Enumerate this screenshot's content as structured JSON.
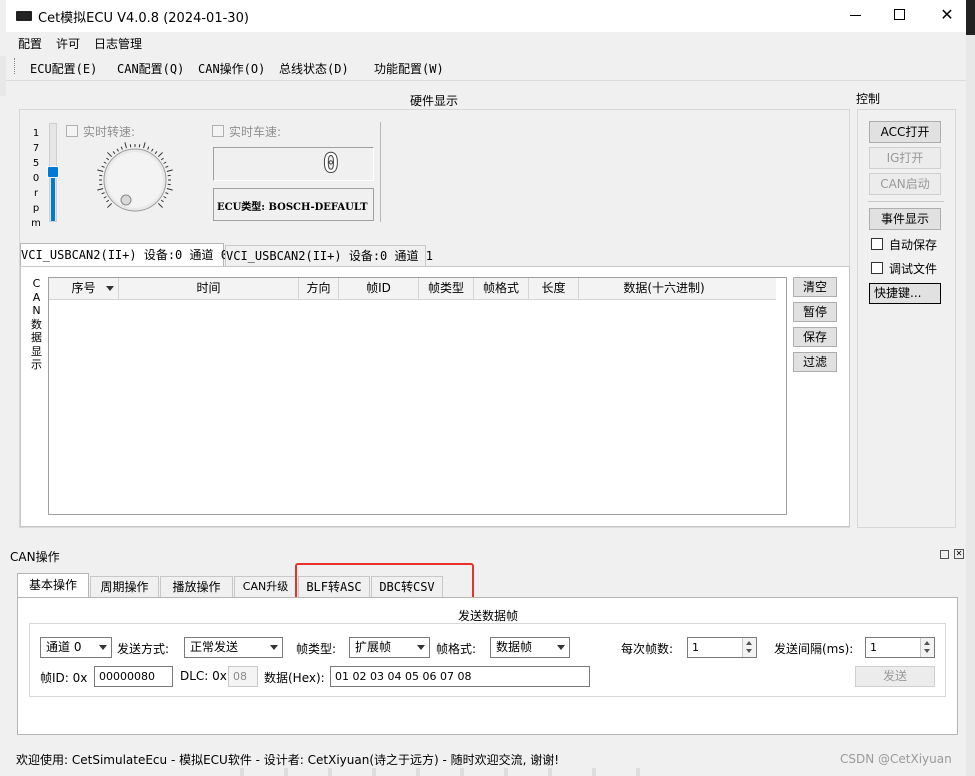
{
  "window": {
    "title": "Cet模拟ECU V4.0.8 (2024-01-30)",
    "minimize_icon": "minimize-icon",
    "maximize_icon": "maximize-icon",
    "close_icon": "close-icon"
  },
  "menubar": {
    "items": [
      "配置",
      "许可",
      "日志管理"
    ]
  },
  "toolbar": {
    "items": [
      "ECU配置(E)",
      "CAN配置(Q)",
      "CAN操作(O)",
      "总线状态(D)",
      "功能配置(W)"
    ]
  },
  "hardware": {
    "title": "硬件显示",
    "rpm_vertical": [
      "1",
      "7",
      "5",
      "0",
      "r",
      "p",
      "m"
    ],
    "slider_level": 0.35,
    "rpm_checkbox_label": "实时转速:",
    "speed_checkbox_label": "实时车速:",
    "speed_value": "0",
    "ecu_type": "ECU类型: BOSCH-DEFAULT"
  },
  "control": {
    "title": "控制",
    "acc_open": "ACC打开",
    "ig_open": "IG打开",
    "can_start": "CAN启动",
    "event_display": "事件显示",
    "auto_save": "自动保存",
    "debug_file": "调试文件",
    "shortcut": "快捷键..."
  },
  "channel_tabs": [
    "VCI_USBCAN2(II+) 设备:0 通道 0",
    "VCI_USBCAN2(II+) 设备:0 通道 1"
  ],
  "can_display": {
    "vertical_label": [
      "C",
      "A",
      "N",
      "数",
      "据",
      "显",
      "示"
    ],
    "columns": [
      "序号",
      "时间",
      "方向",
      "帧ID",
      "帧类型",
      "帧格式",
      "长度",
      "数据(十六进制)"
    ],
    "buttons": [
      "清空",
      "暂停",
      "保存",
      "过滤"
    ]
  },
  "can_ops": {
    "title": "CAN操作",
    "tabs": [
      "基本操作",
      "周期操作",
      "播放操作",
      "CAN升级",
      "BLF转ASC",
      "DBC转CSV"
    ],
    "send_frame_title": "发送数据帧",
    "channel": "通道 0",
    "send_mode_label": "发送方式:",
    "send_mode": "正常发送",
    "frame_type_label": "帧类型:",
    "frame_type": "扩展帧",
    "frame_format_label": "帧格式:",
    "frame_format": "数据帧",
    "frames_per_label": "每次帧数:",
    "frames_per": "1",
    "interval_label": "发送间隔(ms):",
    "interval": "1",
    "frame_id_label": "帧ID: 0x",
    "frame_id": "00000080",
    "dlc_label": "DLC: 0x",
    "dlc": "08",
    "data_label": "数据(Hex):",
    "data": "01 02 03 04 05 06 07 08",
    "send_button": "发送"
  },
  "status": {
    "text": "欢迎使用: CetSimulateEcu - 模拟ECU软件 - 设计者: CetXiyuan(诗之于远方) - 随时欢迎交流, 谢谢!"
  },
  "watermark": "CSDN @CetXiyuan",
  "colors": {
    "highlight_box": "#e8312a",
    "slider_fill": "#0078d7",
    "window_bg": "#f0f0f0"
  }
}
